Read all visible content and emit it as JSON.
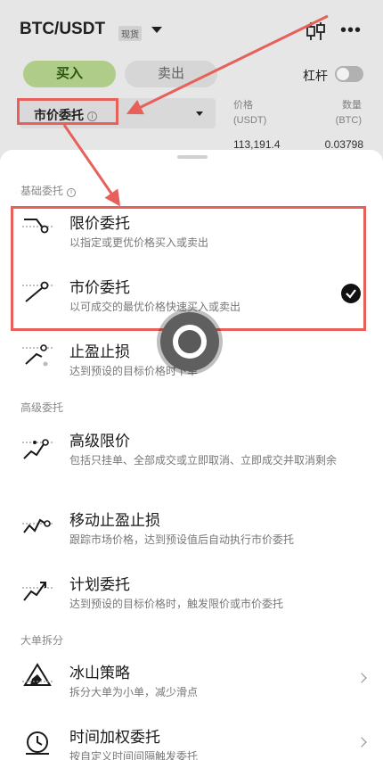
{
  "header": {
    "pair": "BTC/USDT",
    "spot_badge": "现货",
    "candle_icon": "candlestick-chart-icon",
    "more_icon": "more-horizontal-icon"
  },
  "trade": {
    "buy_label": "买入",
    "sell_label": "卖出",
    "leverage_label": "杠杆",
    "leverage_on": false,
    "order_type": "市价委托",
    "info_glyph": "i"
  },
  "orderbook": {
    "price_header_line1": "价格",
    "price_header_line2": "(USDT)",
    "qty_header_line1": "数量",
    "qty_header_line2": "(BTC)",
    "first_price": "113,191.4",
    "first_qty": "0.03798"
  },
  "sheet": {
    "sections": {
      "basic": "基础委托",
      "advanced": "高级委托",
      "split": "大单拆分"
    },
    "options": [
      {
        "title": "限价委托",
        "desc": "以指定或更优价格买入或卖出",
        "icon": "limit-order-icon",
        "selected": false
      },
      {
        "title": "市价委托",
        "desc": "以可成交的最优价格快速买入或卖出",
        "icon": "market-order-icon",
        "selected": true
      },
      {
        "title": "止盈止损",
        "desc": "达到预设的目标价格时下单",
        "icon": "take-profit-stop-loss-icon",
        "selected": false
      },
      {
        "title": "高级限价",
        "desc": "包括只挂单、全部成交或立即取消、立即成交并取消剩余",
        "icon": "advanced-limit-icon",
        "selected": false
      },
      {
        "title": "移动止盈止损",
        "desc": "跟踪市场价格，达到预设值后自动执行市价委托",
        "icon": "trailing-stop-icon",
        "selected": false
      },
      {
        "title": "计划委托",
        "desc": "达到预设的目标价格时，触发限价或市价委托",
        "icon": "trigger-order-icon",
        "selected": false
      },
      {
        "title": "冰山策略",
        "desc": "拆分大单为小单，减少滑点",
        "icon": "iceberg-icon",
        "selected": false
      },
      {
        "title": "时间加权委托",
        "desc": "按自定义时间间隔触发委托",
        "icon": "twap-clock-icon",
        "selected": false
      }
    ]
  },
  "colors": {
    "annotation_red": "#e8605a",
    "buy_green_bg": "#b9d990",
    "buy_green_text": "#2d5a12"
  }
}
